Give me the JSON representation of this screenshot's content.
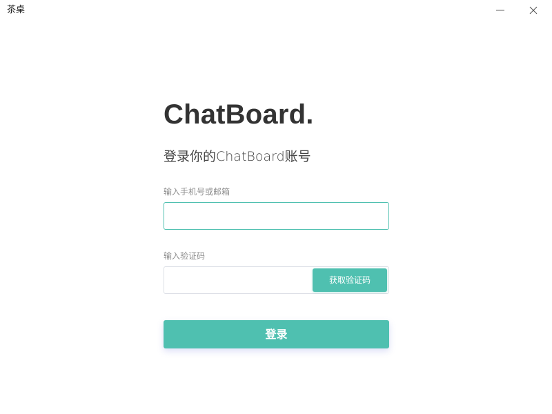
{
  "window": {
    "title": "茶桌",
    "controls": {
      "minimize_icon": "minimize-icon",
      "close_icon": "close-icon"
    }
  },
  "login": {
    "brand": "ChatBoard.",
    "subtitle": "登录你的ChatBoard账号",
    "phone_label": "输入手机号或邮箱",
    "phone_value": "",
    "code_label": "输入验证码",
    "code_value": "",
    "get_code_button": "获取验证码",
    "submit_button": "登录"
  },
  "colors": {
    "accent": "#4fc0b0",
    "text_primary": "#333333",
    "label_gray": "#8f8f8f",
    "input_border": "#dcdfe6"
  }
}
